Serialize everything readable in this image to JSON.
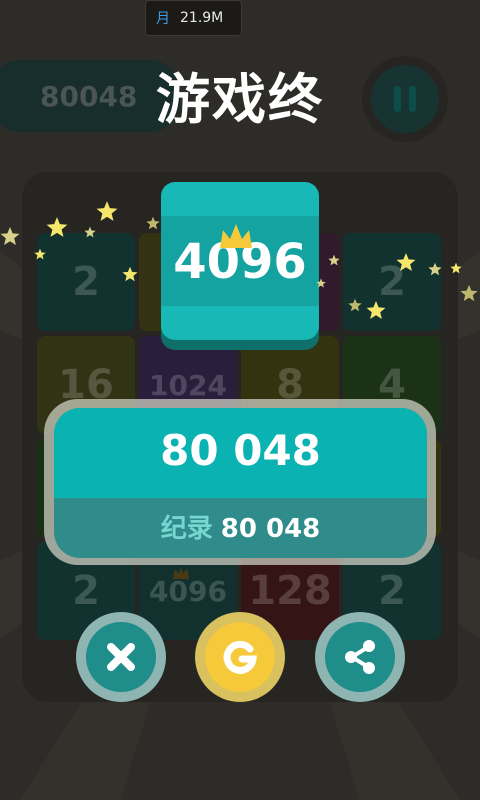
{
  "status": {
    "icon": "月",
    "memory": "21.9M"
  },
  "header": {
    "score_tab": "80048",
    "title": "游戏终"
  },
  "board": {
    "tiles": [
      [
        "2",
        "",
        "",
        "2"
      ],
      [
        "16",
        "1024",
        "8",
        "4"
      ],
      [
        "",
        "",
        "",
        ""
      ],
      [
        "2",
        "4096",
        "128",
        "2"
      ]
    ]
  },
  "achievement": {
    "tile_value": "4096"
  },
  "result": {
    "score": "80 048",
    "record_label": "纪录",
    "record_value": "80 048"
  },
  "actions": {
    "close": "close-icon",
    "restart": "restart-icon",
    "share": "share-icon"
  },
  "colors": {
    "teal": "#17b8b6",
    "teal_dark": "#2f8c8b",
    "yellow": "#f5c93a",
    "background": "#2e2c28"
  }
}
